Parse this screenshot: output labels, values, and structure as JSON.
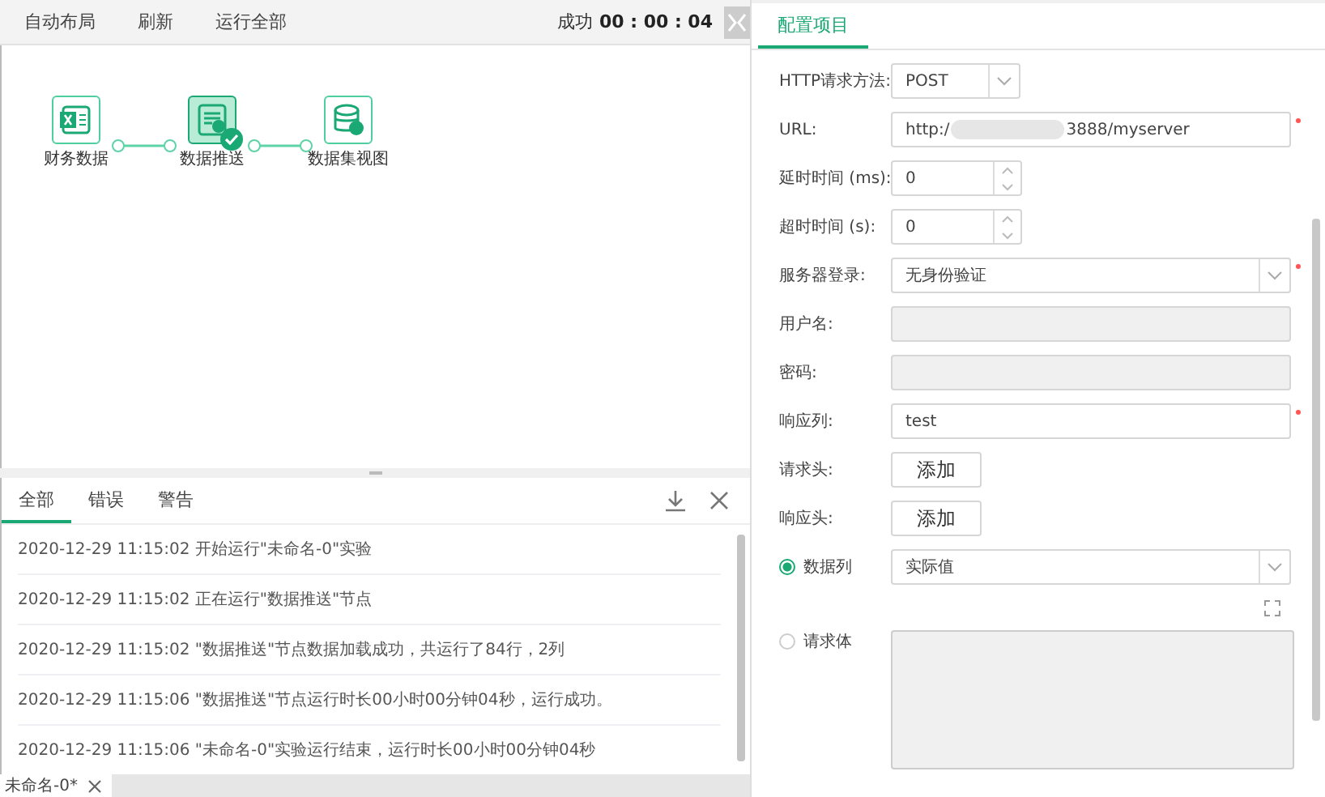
{
  "toolbar": {
    "buttons": [
      "自动布局",
      "刷新",
      "运行全部"
    ],
    "status_label": "成功",
    "status_time": "00 : 00 : 04"
  },
  "flow": {
    "nodes": [
      {
        "label": "财务数据",
        "kind": "excel",
        "selected": false,
        "done": false
      },
      {
        "label": "数据推送",
        "kind": "push",
        "selected": true,
        "done": true
      },
      {
        "label": "数据集视图",
        "kind": "dataset",
        "selected": false,
        "done": false
      }
    ]
  },
  "log_panel": {
    "tabs": [
      {
        "label": "全部",
        "selected": true
      },
      {
        "label": "错误",
        "selected": false
      },
      {
        "label": "警告",
        "selected": false
      }
    ],
    "entries": [
      "2020-12-29 11:15:02 开始运行\"未命名-0\"实验",
      "2020-12-29 11:15:02 正在运行\"数据推送\"节点",
      "2020-12-29 11:15:02 \"数据推送\"节点数据加载成功，共运行了84行，2列",
      "2020-12-29 11:15:06 \"数据推送\"节点运行时长00小时00分钟04秒，运行成功。",
      "2020-12-29 11:15:06 \"未命名-0\"实验运行结束，运行时长00小时00分钟04秒"
    ]
  },
  "doc_tabs": [
    {
      "label": "未命名-0*",
      "selected": true
    }
  ],
  "config": {
    "tab": {
      "label": "配置项目",
      "selected": true
    },
    "rows": [
      {
        "kind": "select",
        "label": "HTTP请求方法:",
        "value": "POST",
        "short": true,
        "required": false
      },
      {
        "kind": "url",
        "label": "URL:",
        "value_start": "http:/",
        "value_end": "3888/myserver",
        "required": true
      },
      {
        "kind": "spinner",
        "label": "延时时间 (ms):",
        "value": "0",
        "required": false
      },
      {
        "kind": "spinner",
        "label": "超时时间 (s):",
        "value": "0",
        "required": false
      },
      {
        "kind": "select",
        "label": "服务器登录:",
        "value": "无身份验证",
        "short": false,
        "required": true
      },
      {
        "kind": "disabled",
        "label": "用户名:",
        "required": false
      },
      {
        "kind": "disabled",
        "label": "密码:",
        "required": false
      },
      {
        "kind": "text",
        "label": "响应列:",
        "value": "test",
        "required": true
      },
      {
        "kind": "button",
        "label": "请求头:",
        "button": "添加",
        "required": false
      },
      {
        "kind": "button",
        "label": "响应头:",
        "button": "添加",
        "required": false
      },
      {
        "kind": "radio-select",
        "label": "数据列",
        "value": "实际值",
        "selected": true,
        "required": false
      },
      {
        "kind": "radio-area",
        "label": "请求体",
        "selected": false,
        "required": false
      }
    ]
  }
}
